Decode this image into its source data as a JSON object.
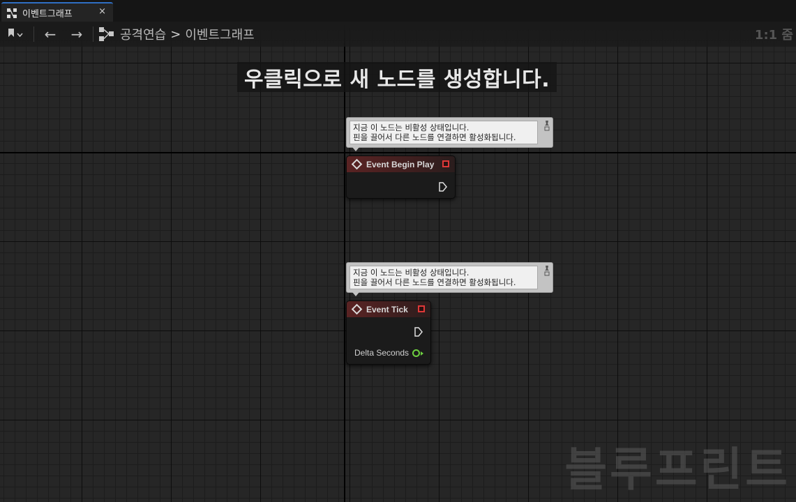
{
  "tab": {
    "label": "이벤트그래프",
    "close": "×"
  },
  "toolbar": {
    "bookmark_icon": "bookmark-icon",
    "back_icon": "←",
    "forward_icon": "→",
    "breadcrumb": {
      "parent": "공격연습",
      "separator": ">",
      "current": "이벤트그래프"
    },
    "zoom": "1:1 줌"
  },
  "hint": "우클릭으로 새 노드를 생성합니다.",
  "comments": [
    {
      "line1": "지금 이 노드는 비활성 상태입니다.",
      "line2": "핀을 끌어서 다른 노드를 연결하면 활성화됩니다."
    },
    {
      "line1": "지금 이 노드는 비활성 상태입니다.",
      "line2": "핀을 끌어서 다른 노드를 연결하면 활성화됩니다."
    }
  ],
  "nodes": [
    {
      "title": "Event Begin Play"
    },
    {
      "title": "Event Tick",
      "pin_label": "Delta Seconds"
    }
  ],
  "watermark": "블루프린트",
  "colors": {
    "tab_accent": "#2f6fc4",
    "event_header": "#5a2323",
    "delegate_pin": "#e03838",
    "float_pin": "#6ed140"
  }
}
